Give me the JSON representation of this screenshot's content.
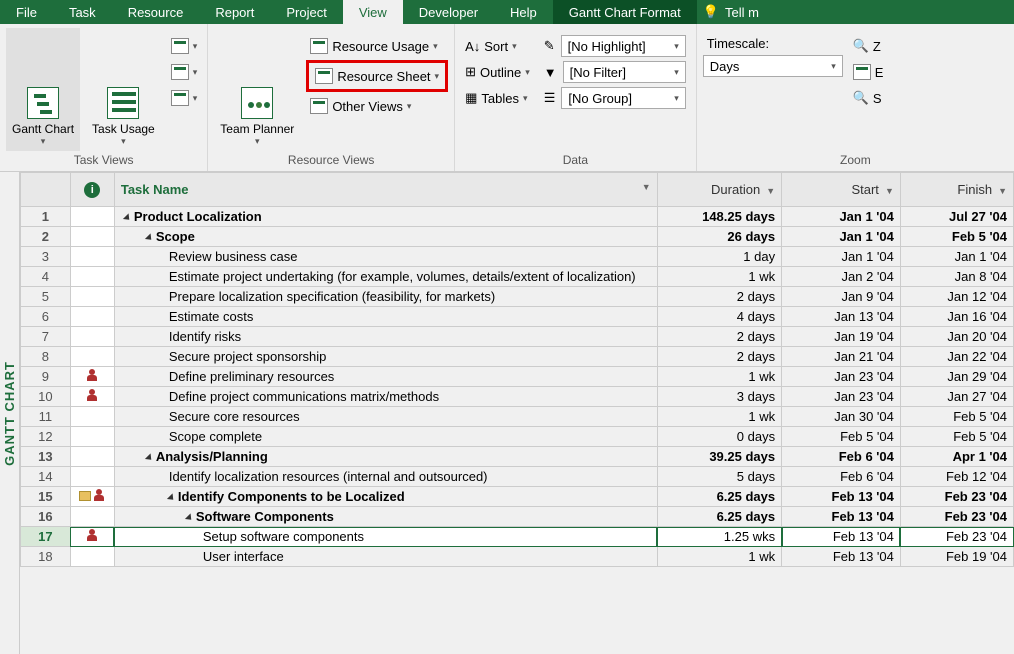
{
  "ribbon_tabs": [
    "File",
    "Task",
    "Resource",
    "Report",
    "Project",
    "View",
    "Developer",
    "Help",
    "Gantt Chart Format"
  ],
  "active_tab": "View",
  "tell_me": "Tell m",
  "groups": {
    "task_views": {
      "label": "Task Views",
      "gantt_chart": "Gantt\nChart",
      "task_usage": "Task\nUsage"
    },
    "resource_views": {
      "label": "Resource Views",
      "team_planner": "Team\nPlanner",
      "resource_usage": "Resource Usage",
      "resource_sheet": "Resource Sheet",
      "other_views": "Other Views"
    },
    "data": {
      "label": "Data",
      "sort": "Sort",
      "outline": "Outline",
      "tables": "Tables",
      "highlight": "[No Highlight]",
      "filter": "[No Filter]",
      "group": "[No Group]"
    },
    "zoom": {
      "label": "Zoom",
      "timescale_label": "Timescale:",
      "timescale_value": "Days",
      "z": "Z",
      "e": "E",
      "s": "S"
    }
  },
  "side_label": "GANTT CHART",
  "columns": {
    "task_name": "Task Name",
    "duration": "Duration",
    "start": "Start",
    "finish": "Finish"
  },
  "rows": [
    {
      "n": 1,
      "ind": "",
      "lvl": "indent0",
      "tri": true,
      "bold": true,
      "name": "Product Localization",
      "dur": "148.25 days",
      "start": "Jan 1 '04",
      "finish": "Jul 27 '04"
    },
    {
      "n": 2,
      "ind": "",
      "lvl": "indent1",
      "tri": true,
      "bold": true,
      "name": "Scope",
      "dur": "26 days",
      "start": "Jan 1 '04",
      "finish": "Feb 5 '04"
    },
    {
      "n": 3,
      "ind": "",
      "lvl": "indent2",
      "bold": false,
      "name": "Review business case",
      "dur": "1 day",
      "start": "Jan 1 '04",
      "finish": "Jan 1 '04"
    },
    {
      "n": 4,
      "ind": "",
      "lvl": "indent2",
      "bold": false,
      "name": "Estimate project undertaking (for example, volumes, details/extent of localization)",
      "dur": "1 wk",
      "start": "Jan 2 '04",
      "finish": "Jan 8 '04",
      "wrap": true
    },
    {
      "n": 5,
      "ind": "",
      "lvl": "indent2",
      "bold": false,
      "name": "Prepare localization specification (feasibility, for markets)",
      "dur": "2 days",
      "start": "Jan 9 '04",
      "finish": "Jan 12 '04"
    },
    {
      "n": 6,
      "ind": "",
      "lvl": "indent2",
      "bold": false,
      "name": "Estimate costs",
      "dur": "4 days",
      "start": "Jan 13 '04",
      "finish": "Jan 16 '04"
    },
    {
      "n": 7,
      "ind": "",
      "lvl": "indent2",
      "bold": false,
      "name": "Identify risks",
      "dur": "2 days",
      "start": "Jan 19 '04",
      "finish": "Jan 20 '04"
    },
    {
      "n": 8,
      "ind": "",
      "lvl": "indent2",
      "bold": false,
      "name": "Secure project sponsorship",
      "dur": "2 days",
      "start": "Jan 21 '04",
      "finish": "Jan 22 '04"
    },
    {
      "n": 9,
      "ind": "person",
      "lvl": "indent2",
      "bold": false,
      "name": "Define preliminary resources",
      "dur": "1 wk",
      "start": "Jan 23 '04",
      "finish": "Jan 29 '04"
    },
    {
      "n": 10,
      "ind": "person",
      "lvl": "indent2",
      "bold": false,
      "name": "Define project communications matrix/methods",
      "dur": "3 days",
      "start": "Jan 23 '04",
      "finish": "Jan 27 '04"
    },
    {
      "n": 11,
      "ind": "",
      "lvl": "indent2",
      "bold": false,
      "name": "Secure core resources",
      "dur": "1 wk",
      "start": "Jan 30 '04",
      "finish": "Feb 5 '04"
    },
    {
      "n": 12,
      "ind": "",
      "lvl": "indent2",
      "bold": false,
      "name": "Scope complete",
      "dur": "0 days",
      "start": "Feb 5 '04",
      "finish": "Feb 5 '04"
    },
    {
      "n": 13,
      "ind": "",
      "lvl": "indent1b",
      "tri": true,
      "bold": true,
      "name": "Analysis/Planning",
      "dur": "39.25 days",
      "start": "Feb 6 '04",
      "finish": "Apr 1 '04"
    },
    {
      "n": 14,
      "ind": "",
      "lvl": "indent2",
      "bold": false,
      "name": "Identify localization resources (internal and outsourced)",
      "dur": "5 days",
      "start": "Feb 6 '04",
      "finish": "Feb 12 '04"
    },
    {
      "n": 15,
      "ind": "note-person",
      "lvl": "indent2b",
      "tri": true,
      "bold": true,
      "name": "Identify Components to be Localized",
      "dur": "6.25 days",
      "start": "Feb 13 '04",
      "finish": "Feb 23 '04"
    },
    {
      "n": 16,
      "ind": "",
      "lvl": "indent3b",
      "tri": true,
      "bold": true,
      "name": "Software Components",
      "dur": "6.25 days",
      "start": "Feb 13 '04",
      "finish": "Feb 23 '04"
    },
    {
      "n": 17,
      "ind": "person",
      "lvl": "indent4",
      "bold": false,
      "name": "Setup software components",
      "dur": "1.25 wks",
      "start": "Feb 13 '04",
      "finish": "Feb 23 '04",
      "selected": true
    },
    {
      "n": 18,
      "ind": "",
      "lvl": "indent4",
      "bold": false,
      "name": "User interface",
      "dur": "1 wk",
      "start": "Feb 13 '04",
      "finish": "Feb 19 '04"
    }
  ]
}
